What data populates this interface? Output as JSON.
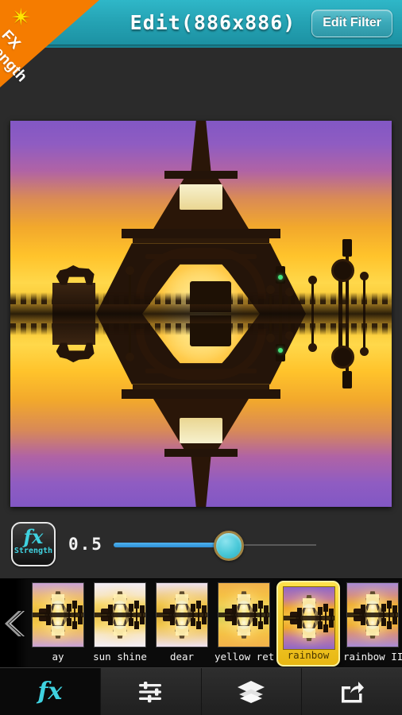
{
  "header": {
    "title": "Edit(886x886)",
    "edit_filter_label": "Edit Filter",
    "accent_color": "#25a3b4"
  },
  "ribbon": {
    "line1": "FX",
    "line2": "Strength",
    "star_icon": "star-icon",
    "color": "#f57c00"
  },
  "canvas": {
    "image_description": "Eiffel Tower at sunset with mirrored reflection",
    "width_label": "886",
    "height_label": "886"
  },
  "slider": {
    "button_fx_label": "fx",
    "button_strength_label": "Strength",
    "value": "0.5",
    "fill_percent": 57,
    "min": 0,
    "max": 1,
    "thumb_color": "#49c8d8",
    "fill_color": "#3ba3e3"
  },
  "filters": {
    "prev_arrow_icon": "chevron-left-icon",
    "selected_index": 4,
    "items": [
      {
        "label": "ay",
        "selected": false
      },
      {
        "label": "sun shine",
        "selected": false
      },
      {
        "label": "dear",
        "selected": false
      },
      {
        "label": "yellow ret",
        "selected": false
      },
      {
        "label": "rainbow",
        "selected": true
      },
      {
        "label": "rainbow II",
        "selected": false
      }
    ]
  },
  "bottom_nav": {
    "items": [
      {
        "name": "fx",
        "label": "fx",
        "icon": "fx-icon",
        "active": true
      },
      {
        "name": "adjust",
        "label": "",
        "icon": "sliders-icon",
        "active": false
      },
      {
        "name": "layers",
        "label": "",
        "icon": "layers-icon",
        "active": false
      },
      {
        "name": "share",
        "label": "",
        "icon": "share-icon",
        "active": false
      }
    ]
  }
}
